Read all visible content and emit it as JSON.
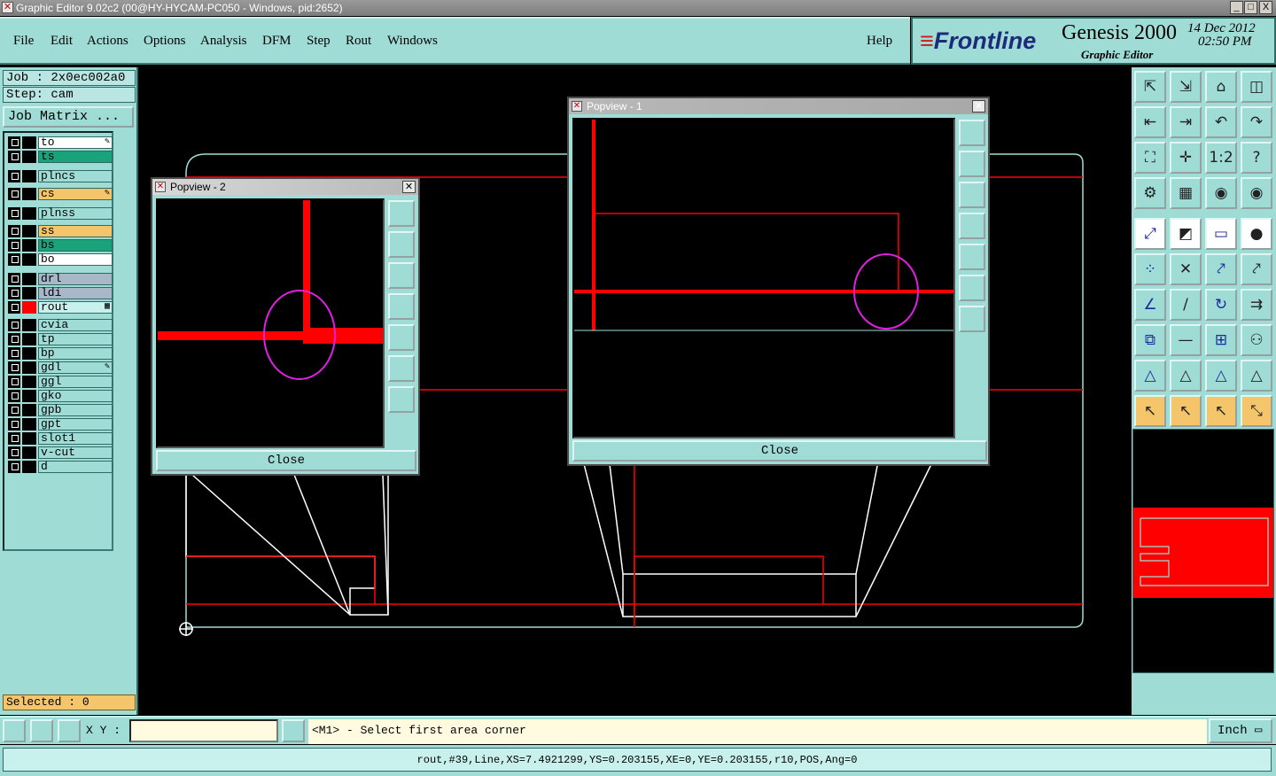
{
  "window": {
    "title": "Graphic Editor 9.02c2 (00@HY-HYCAM-PC050 - Windows, pid:2652)",
    "controls": [
      "_",
      "□",
      "X"
    ]
  },
  "menu": [
    "File",
    "Edit",
    "Actions",
    "Options",
    "Analysis",
    "DFM",
    "Step",
    "Rout",
    "Windows"
  ],
  "help_label": "Help",
  "brand": {
    "logo": "Frontline",
    "product": "Genesis 2000",
    "subtitle": "Graphic Editor",
    "date": "14 Dec 2012",
    "time": "02:50 PM"
  },
  "job": {
    "job_label": "Job : 2x0ec002a0",
    "step_label": "Step: cam",
    "job_matrix_label": "Job Matrix ..."
  },
  "layers": [
    {
      "name": "to",
      "color": "#ffffff",
      "swatch": "#000000",
      "mark": "✎"
    },
    {
      "name": "ts",
      "color": "#1aa37a",
      "swatch": "#000000",
      "mark": ""
    },
    {
      "name": "plncs",
      "color": "#9fdcd6",
      "swatch": "#000000",
      "mark": ""
    },
    {
      "name": "cs",
      "color": "#f4c56a",
      "swatch": "#000000",
      "mark": "✎"
    },
    {
      "name": "plnss",
      "color": "#9fdcd6",
      "swatch": "#000000",
      "mark": ""
    },
    {
      "name": "ss",
      "color": "#f4c56a",
      "swatch": "#000000",
      "mark": ""
    },
    {
      "name": "bs",
      "color": "#1aa37a",
      "swatch": "#000000",
      "mark": ""
    },
    {
      "name": "bo",
      "color": "#ffffff",
      "swatch": "#000000",
      "mark": ""
    },
    {
      "name": "drl",
      "color": "#a8b8c8",
      "swatch": "#000000",
      "mark": ""
    },
    {
      "name": "ldi",
      "color": "#a8b8c8",
      "swatch": "#000000",
      "mark": ""
    },
    {
      "name": "rout",
      "color": "#c8f0ec",
      "swatch": "#ff0000",
      "mark": "▦"
    },
    {
      "name": "cvia",
      "color": "#9fdcd6",
      "swatch": "#000000",
      "mark": ""
    },
    {
      "name": "tp",
      "color": "#9fdcd6",
      "swatch": "#000000",
      "mark": ""
    },
    {
      "name": "bp",
      "color": "#9fdcd6",
      "swatch": "#000000",
      "mark": ""
    },
    {
      "name": "gdl",
      "color": "#9fdcd6",
      "swatch": "#000000",
      "mark": "✎"
    },
    {
      "name": "ggl",
      "color": "#9fdcd6",
      "swatch": "#000000",
      "mark": ""
    },
    {
      "name": "gko",
      "color": "#9fdcd6",
      "swatch": "#000000",
      "mark": ""
    },
    {
      "name": "gpb",
      "color": "#9fdcd6",
      "swatch": "#000000",
      "mark": ""
    },
    {
      "name": "gpt",
      "color": "#9fdcd6",
      "swatch": "#000000",
      "mark": ""
    },
    {
      "name": "slot1",
      "color": "#9fdcd6",
      "swatch": "#000000",
      "mark": ""
    },
    {
      "name": "v-cut",
      "color": "#9fdcd6",
      "swatch": "#000000",
      "mark": ""
    },
    {
      "name": "d",
      "color": "#9fdcd6",
      "swatch": "#000000",
      "mark": ""
    }
  ],
  "selected_label": "Selected : 0",
  "coords": {
    "xy_label": "X Y :",
    "xy_value": "",
    "prompt": "<M1> - Select first area corner",
    "units": "Inch"
  },
  "status_line": "rout,#39,Line,XS=7.4921299,YS=0.203155,XE=0,YE=0.203155,r10,POS,Ang=0",
  "popview1": {
    "title": "Popview - 1",
    "close_label": "Close"
  },
  "popview2": {
    "title": "Popview - 2",
    "close_label": "Close"
  },
  "toolbar_icons": [
    "open-job-icon",
    "close-job-icon",
    "home-icon",
    "split-window-icon",
    "pan-left-icon",
    "pan-right-icon",
    "undo-icon",
    "redo-icon",
    "zoom-fit-icon",
    "zoom-home-icon",
    "ratio-icon",
    "help-icon",
    "settings-icon",
    "grid-icon",
    "layer-red-icon",
    "layer-edit-icon",
    "snap-icon",
    "measure-icon",
    "ruler-icon",
    "pad-icon",
    "move-icon",
    "delete-icon",
    "connect-icon",
    "line-icon",
    "angle-icon",
    "slash-icon",
    "arc-icon",
    "text-icon",
    "copy-icon",
    "cut-icon",
    "transform-icon",
    "array-icon",
    "triangle-icon",
    "mirror-icon",
    "stretch-icon",
    "rotate-icon",
    "select-icon",
    "select-box-icon",
    "select-poly-icon",
    "select-net-icon"
  ],
  "colors": {
    "panel": "#9fdcd6",
    "rout": "#ff0000",
    "outline": "#ffffff",
    "highlight": "#e020e0"
  }
}
